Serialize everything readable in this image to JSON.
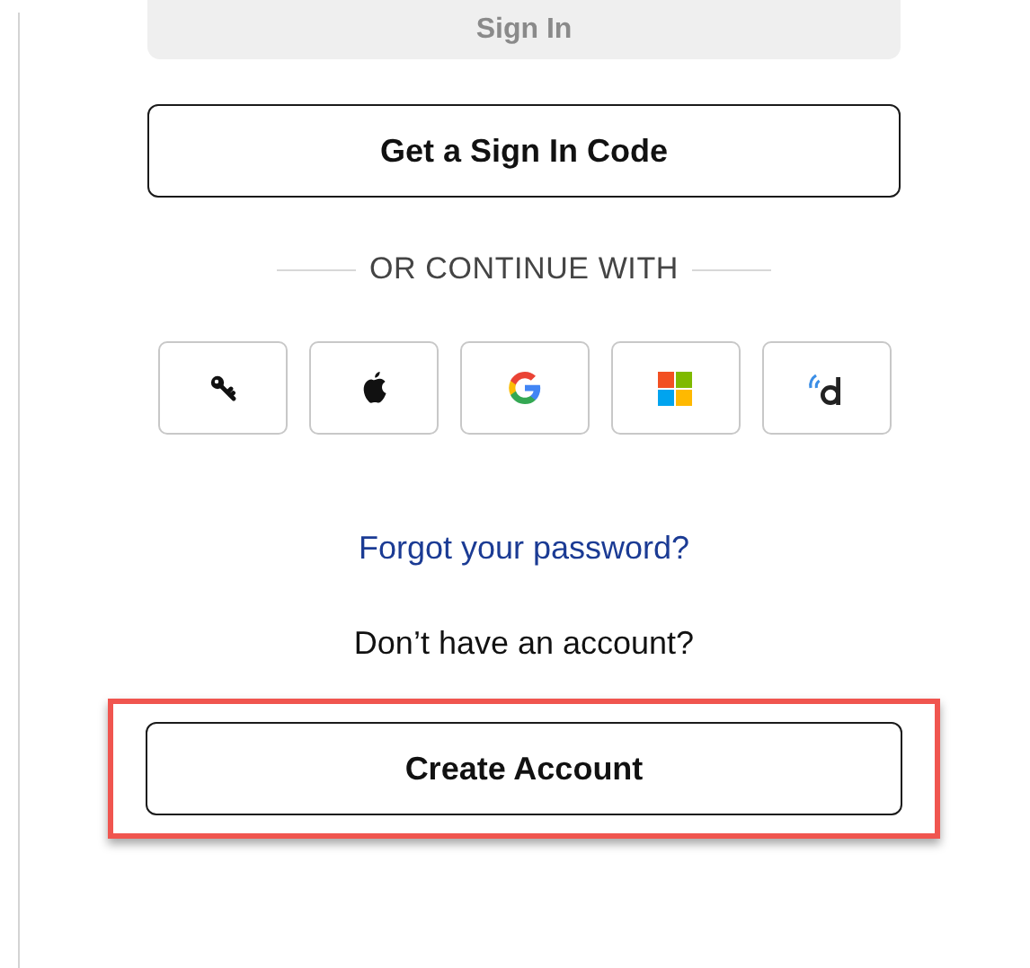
{
  "sign_in_button": {
    "label": "Sign In",
    "disabled": true
  },
  "code_button": {
    "label": "Get a Sign In Code"
  },
  "divider": {
    "label": "OR CONTINUE WITH"
  },
  "social_buttons": [
    {
      "kind": "passkey"
    },
    {
      "kind": "apple"
    },
    {
      "kind": "google"
    },
    {
      "kind": "microsoft"
    },
    {
      "kind": "dashlane"
    }
  ],
  "forgot_link": "Forgot your password?",
  "account_prompt": "Don’t have an account?",
  "create_button": {
    "label": "Create Account",
    "highlighted": true
  }
}
